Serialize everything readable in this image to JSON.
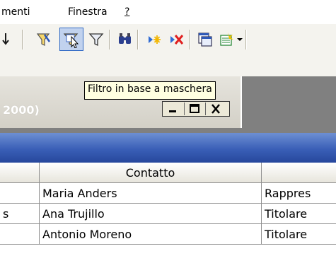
{
  "menu": {
    "items": [
      {
        "label": "menti"
      },
      {
        "label": "Finestra"
      },
      {
        "label": "?"
      }
    ]
  },
  "tooltip": {
    "text": "Filtro in base a maschera"
  },
  "child_window": {
    "title_fragment": "2000)",
    "controls": [
      "minimize-icon",
      "maximize-icon",
      "close-icon"
    ]
  },
  "table": {
    "columns": [
      "",
      "Contatto",
      ""
    ],
    "rows": [
      [
        "",
        "Maria Anders",
        "Rappres"
      ],
      [
        "s",
        "Ana Trujillo",
        "Titolare"
      ],
      [
        "",
        "Antonio Moreno",
        "Titolare"
      ]
    ]
  },
  "toolbar": {
    "icons": [
      "sort-descending-icon",
      "filter-by-selection-icon",
      "filter-by-form-icon",
      "apply-filter-icon",
      "find-icon",
      "new-record-icon",
      "delete-record-icon",
      "database-window-icon",
      "new-object-icon",
      "dropdown-arrow-icon"
    ]
  },
  "colors": {
    "toolbar_bg": "#f4f3ee",
    "hover_bg": "#c1d2ee",
    "tooltip_bg": "#ffffe1",
    "header_band": "#3a5fb7"
  }
}
